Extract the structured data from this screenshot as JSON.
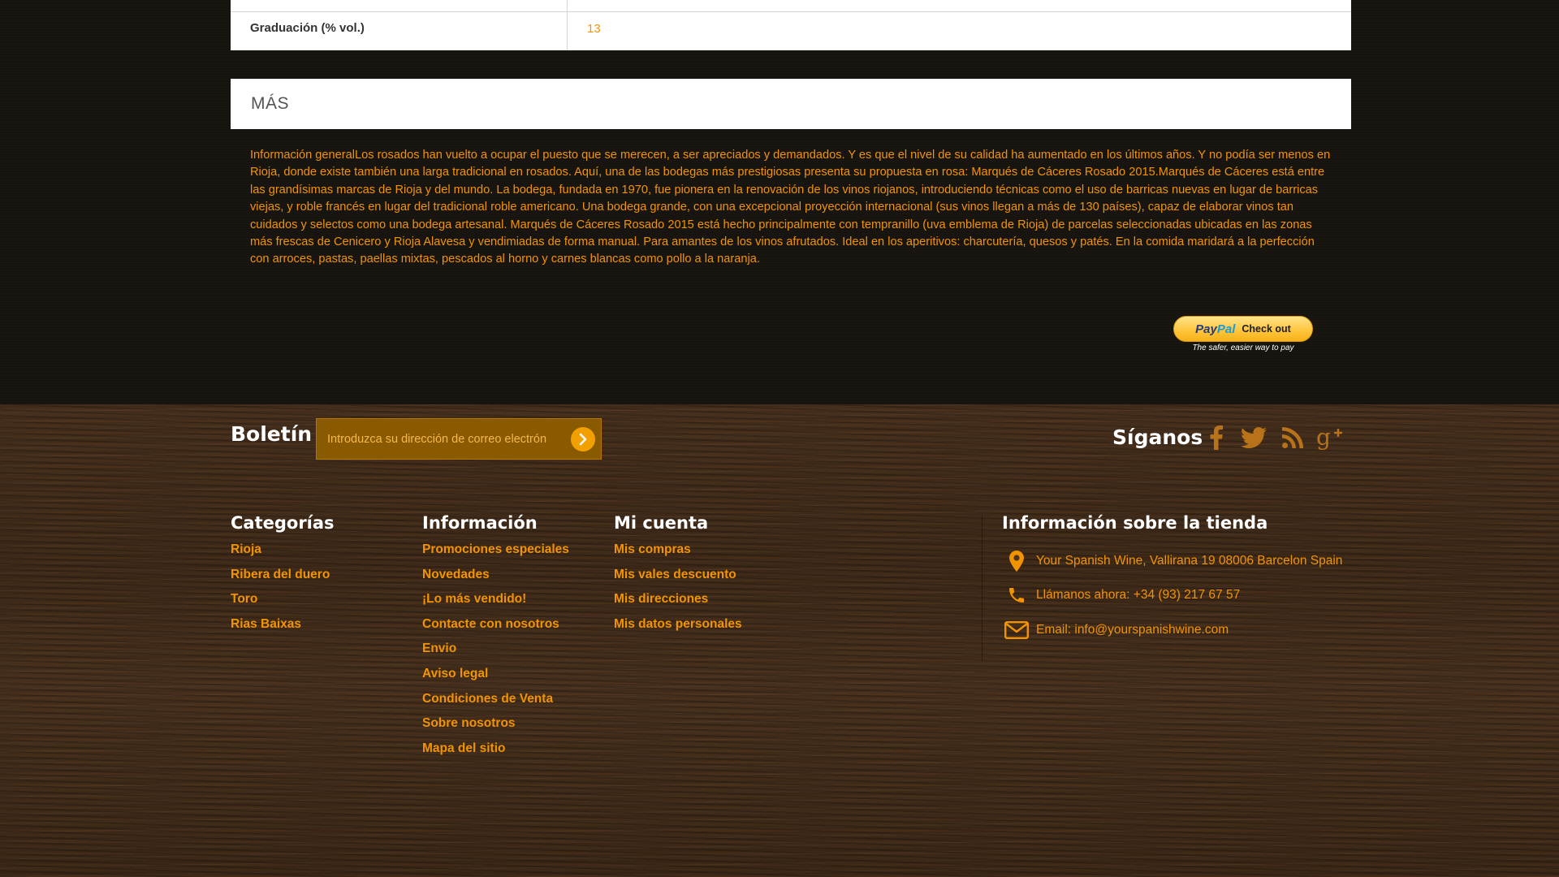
{
  "spec": {
    "label": "Graduación (% vol.)",
    "value": "13"
  },
  "more": {
    "title": "MÁS",
    "description": "Información generalLos rosados han vuelto a ocupar el puesto que se merecen, a ser apreciados y demandados. Y es que el nivel de su calidad ha aumentado en los últimos años. Y no podía ser menos en Rioja, donde existe también una larga tradicional en rosados. Aquí, una de las bodegas más prestigiosas presenta su propuesta en rosa: Marqués de Cáceres Rosado 2015.Marqués de Cáceres está entre las grandísimas marcas de Rioja y del mundo. La bodega, fundada en 1970, fue pionera en la renovación de los vinos riojanos, introduciendo técnicas como el uso de barricas nuevas en lugar de barricas viejas, y roble francés en lugar del tradicional roble americano. Una bodega grande, con una excepcional proyección internacional (sus vinos llegan a más de 130 países), capaz de elaborar vinos tan cuidados y selectos como una bodega artesanal. Marqués de Cáceres Rosado 2015 está hecho principalmente con tempranillo (uva emblema de Rioja) de parcelas seleccionadas ubicadas en las zonas más frescas de Cenicero y Rioja Alavesa y vendimiadas de forma manual. Para amantes de los vinos afrutados. Ideal en los aperitivos: charcutería, quesos y patés. En la comida maridará a la perfección con arroces, pastas, paellas mixtas, pescados al horno y carnes blancas como pollo a la naranja."
  },
  "paypal": {
    "logo_pay": "Pay",
    "logo_pal": "Pal",
    "button_label": "Check out",
    "tagline": "The safer, easier way to pay"
  },
  "newsletter": {
    "title": "Boletín",
    "placeholder": "Introduzca su dirección de correo electrón",
    "submit_icon": "chevron-right-circle-icon"
  },
  "follow": {
    "title": "Síganos",
    "networks": [
      "facebook-icon",
      "twitter-icon",
      "rss-icon",
      "google-plus-icon"
    ]
  },
  "categories": {
    "title": "Categorías",
    "items": [
      "Rioja",
      "Ribera del duero",
      "Toro",
      "Rias Baixas"
    ]
  },
  "information": {
    "title": "Información",
    "items": [
      "Promociones especiales",
      "Novedades",
      "¡Lo más vendido!",
      "Contacte con nosotros",
      "Envio",
      "Aviso legal",
      "Condiciones de Venta",
      "Sobre nosotros",
      "Mapa del sitio"
    ]
  },
  "account": {
    "title": "Mi cuenta",
    "items": [
      "Mis compras",
      "Mis vales descuento",
      "Mis direcciones",
      "Mis datos personales"
    ]
  },
  "store": {
    "title": "Información sobre la tienda",
    "address": "Your Spanish Wine, Vallirana 19 08006 Barcelon Spain",
    "phone": "Llámanos ahora: +34 (93) 217 67 57",
    "email": "Email: info@yourspanishwine.com"
  },
  "colors": {
    "accent": "#f29400",
    "page_bg": "#17140f",
    "panel_bg": "#ffffff"
  }
}
